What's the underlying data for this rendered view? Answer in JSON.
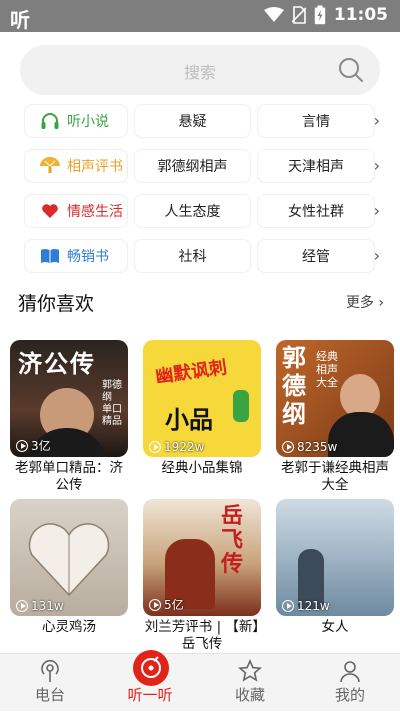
{
  "status_bar": {
    "app_glyph": "听",
    "time": "11:05",
    "icons": [
      "wifi-icon",
      "no-sim-icon",
      "battery-charging-icon"
    ]
  },
  "search": {
    "placeholder": "搜索",
    "icon": "search-icon"
  },
  "categories": [
    {
      "label": "听小说",
      "icon": "headphones-icon",
      "color": "#3aa443",
      "items": [
        "悬疑",
        "言情"
      ]
    },
    {
      "label": "相声评书",
      "icon": "fan-icon",
      "color": "#e9a02b",
      "items": [
        "郭德纲相声",
        "天津相声"
      ]
    },
    {
      "label": "情感生活",
      "icon": "heart-icon",
      "color": "#d92b2b",
      "items": [
        "人生态度",
        "女性社群"
      ]
    },
    {
      "label": "畅销书",
      "icon": "book-icon",
      "color": "#2f7dd4",
      "items": [
        "社科",
        "经管"
      ]
    }
  ],
  "recommend": {
    "title": "猜你喜欢",
    "more": "更多",
    "cards": [
      {
        "title": "老郭单口精品：济公传",
        "plays": "3亿",
        "cover_text": "济公传",
        "cover_sub": "郭德纲 单口精品"
      },
      {
        "title": "经典小品集锦",
        "plays": "1922w",
        "cover_text": "小品",
        "cover_sub": "幽默讽刺"
      },
      {
        "title": "老郭于谦经典相声大全",
        "plays": "8235w",
        "cover_text": "郭德纲",
        "cover_sub": "经典 相声大全"
      },
      {
        "title": "心灵鸡汤",
        "plays": "131w",
        "cover_text": "",
        "cover_sub": ""
      },
      {
        "title": "刘兰芳评书 | 【新】岳飞传",
        "plays": "5亿",
        "cover_text": "岳飞传",
        "cover_sub": ""
      },
      {
        "title": "女人",
        "plays": "121w",
        "cover_text": "",
        "cover_sub": ""
      }
    ]
  },
  "bottom_nav": [
    {
      "label": "电台",
      "icon": "radio-tower-icon",
      "active": false
    },
    {
      "label": "听一听",
      "icon": "listen-disc-icon",
      "active": true
    },
    {
      "label": "收藏",
      "icon": "star-icon",
      "active": false
    },
    {
      "label": "我的",
      "icon": "user-icon",
      "active": false
    }
  ],
  "colors": {
    "accent": "#e2231a",
    "status_bar": "#7e7e7e"
  }
}
